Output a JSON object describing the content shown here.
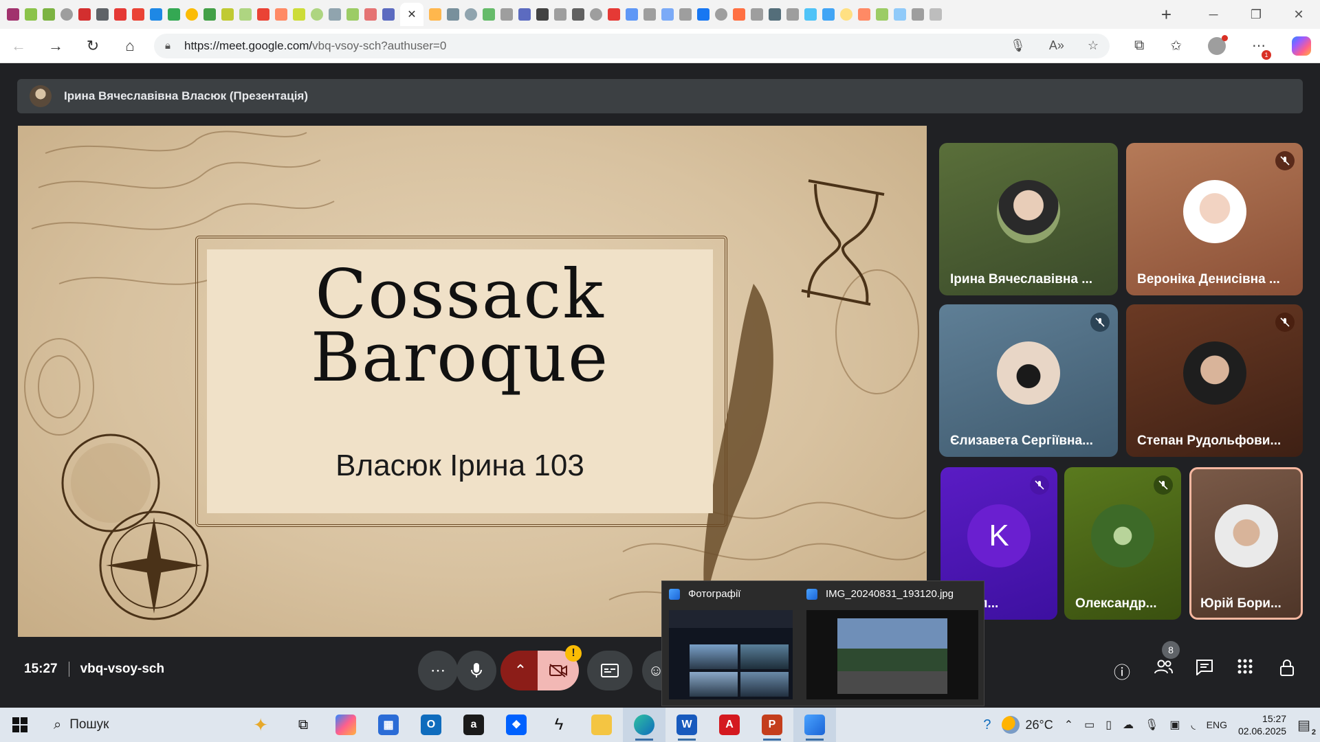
{
  "browser": {
    "url_host": "https://meet.google.com/",
    "url_path": "vbq-vsoy-sch?authuser=0",
    "new_tab_label": "+",
    "tab_favicon_colors": [
      "#a1326d",
      "#8bc34a",
      "#7cb342",
      "#9e9e9e",
      "#d32f2f",
      "#5f6368",
      "#e53935",
      "#ea4335",
      "#1e88e5",
      "#34a853",
      "#fbbc04",
      "#43a047",
      "#c0ca33",
      "#aed581",
      "#ea4335",
      "#ff8a65",
      "#cddc39",
      "#aed581",
      "#90a4ae",
      "#9ccc65",
      "#e57373",
      "#5c6bc0",
      "#ffb74d",
      "#78909c",
      "#90a4ae",
      "#66bb6a",
      "#9e9e9e",
      "#5c6bc0",
      "#424242",
      "#9e9e9e",
      "#616161",
      "#9e9e9e",
      "#e53935",
      "#5e97f6",
      "#9e9e9e",
      "#7baaf7",
      "#9e9e9e",
      "#1877f2",
      "#9e9e9e",
      "#ff7043",
      "#9e9e9e",
      "#546e7a",
      "#9e9e9e",
      "#4fc3f7",
      "#42a5f5",
      "#ffe082",
      "#ff8a65",
      "#9ccc65",
      "#90caf9",
      "#9e9e9e",
      "#bdbdbd"
    ]
  },
  "meet": {
    "presenter_label": "Ірина Вячеславівна Власюк (Презентація)",
    "slide": {
      "title_line1": "Cossack",
      "title_line2": "Baroque",
      "subtitle": "Власюк Ірина 103"
    },
    "participants": [
      {
        "name": "Ірина Вячеславівна ...",
        "muted": false
      },
      {
        "name": "Вероніка Денисівна ...",
        "muted": true
      },
      {
        "name": "Єлизавета Сергіївна...",
        "muted": true
      },
      {
        "name": "Степан Рудольфови...",
        "muted": true
      },
      {
        "name": "н Озп...",
        "letter": "K",
        "muted": true
      },
      {
        "name": "Олександр...",
        "muted": true
      },
      {
        "name": "Юрій Бори...",
        "muted": false
      }
    ],
    "clock": "15:27",
    "meeting_code": "vbq-vsoy-sch",
    "people_count": "8",
    "camera_warning": "!"
  },
  "thumbnail_popup": {
    "items": [
      {
        "title": "Фотографії"
      },
      {
        "title": "IMG_20240831_193120.jpg"
      }
    ]
  },
  "taskbar": {
    "search_placeholder": "Пошук",
    "weather_temp": "26°C",
    "language": "ENG",
    "time": "15:27",
    "date": "02.06.2025",
    "notification_count": "2"
  }
}
